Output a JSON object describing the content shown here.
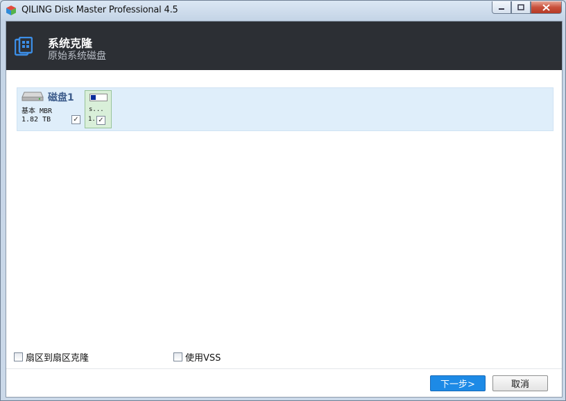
{
  "window": {
    "title": "QILING Disk Master Professional 4.5"
  },
  "header": {
    "title": "系统克隆",
    "subtitle": "原始系统磁盘"
  },
  "disk": {
    "name": "磁盘1",
    "type": "基本 MBR",
    "size": "1.82 TB",
    "checked": true,
    "partition": {
      "label": "s...",
      "size": "1.",
      "checked": true,
      "used_fraction": 0.33
    }
  },
  "options": {
    "sector_clone_label": "扇区到扇区克隆",
    "use_vss_label": "使用VSS"
  },
  "buttons": {
    "next_label": "下一步>",
    "cancel_label": "取消"
  },
  "colors": {
    "header_bg": "#2c2f34",
    "accent": "#1d8ae6",
    "partition_bg": "#d9efd9",
    "disk_row_bg": "#dfeefa"
  }
}
